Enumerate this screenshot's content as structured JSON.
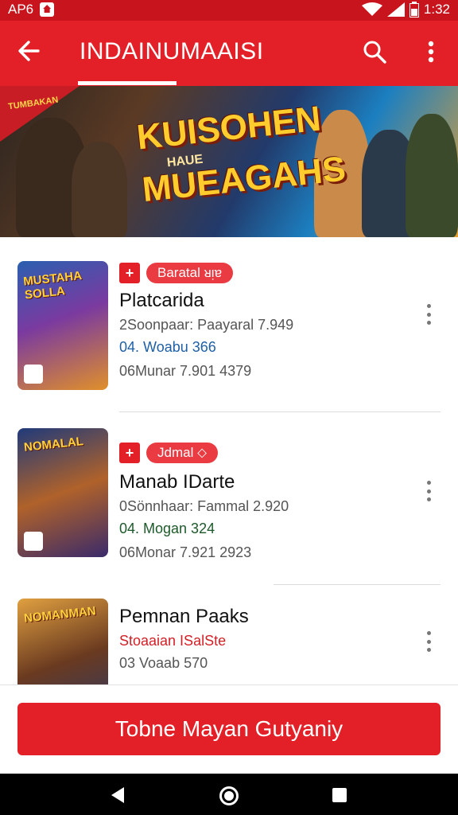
{
  "status_bar": {
    "left_text": "AP6",
    "time": "1:32"
  },
  "app_bar": {
    "title": "INDAINUMAAISI"
  },
  "banner": {
    "corner_text": "TUMBAKAN",
    "headline_line1": "KUISOHEN",
    "headline_line2": "MUEAGAHS",
    "sub_text": "HAUE"
  },
  "games": [
    {
      "thumb_text": "MUSTAHA SOLLA",
      "tag": "Baratal ᴚᴉɐ",
      "name": "Platcarida",
      "meta1": "2Soonpaar: Paayaral 7.949",
      "meta2": "04. Woabu 366",
      "meta3": "06Munar 7.901 4379"
    },
    {
      "thumb_text": "NOMALAL",
      "tag": "Jdmal ⬦",
      "name": "Manab IDarte",
      "meta1": "0Sönnhaar: Fammal 2.920",
      "meta2": "04. Mogan 324",
      "meta3": "06Monar 7.921 2923"
    },
    {
      "thumb_text": "NOMANMAN",
      "name": "Pemnan Paaks",
      "meta1": "Stoaaian ISalSte",
      "meta2": "03 Voaab 570"
    }
  ],
  "cta": {
    "label": "Tobne Mayan Gutyaniy"
  },
  "colors": {
    "primary": "#e32027",
    "status": "#c8141c"
  }
}
